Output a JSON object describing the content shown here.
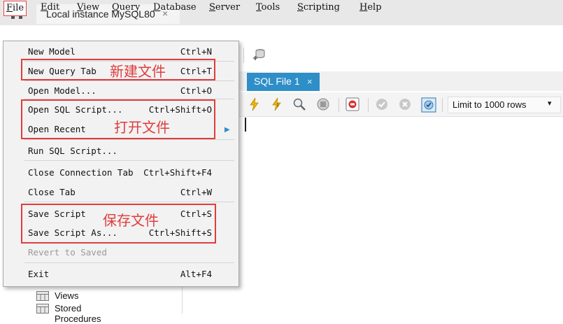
{
  "tabs": {
    "connection_title": "Local instance MySQL80",
    "close_glyph": "×"
  },
  "menubar": {
    "items": [
      {
        "pre": "",
        "key": "F",
        "post": "ile"
      },
      {
        "pre": "",
        "key": "E",
        "post": "dit"
      },
      {
        "pre": "",
        "key": "V",
        "post": "iew"
      },
      {
        "pre": "",
        "key": "Q",
        "post": "uery"
      },
      {
        "pre": "",
        "key": "D",
        "post": "atabase"
      },
      {
        "pre": "",
        "key": "S",
        "post": "erver"
      },
      {
        "pre": "",
        "key": "T",
        "post": "ools"
      },
      {
        "pre": "",
        "key": "S",
        "post": "cripting"
      },
      {
        "pre": "",
        "key": "H",
        "post": "elp"
      }
    ]
  },
  "file_menu": {
    "new_model": {
      "label": "New Model",
      "shortcut": "Ctrl+N"
    },
    "new_query_tab": {
      "label": "New Query Tab",
      "shortcut": "Ctrl+T"
    },
    "open_model": {
      "label": "Open Model...",
      "shortcut": "Ctrl+O"
    },
    "open_sql_script": {
      "label": "Open SQL Script...",
      "shortcut": "Ctrl+Shift+O"
    },
    "open_recent": {
      "label": "Open Recent",
      "shortcut": ""
    },
    "run_sql_script": {
      "label": "Run SQL Script...",
      "shortcut": ""
    },
    "close_connection_tab": {
      "label": "Close Connection Tab",
      "shortcut": "Ctrl+Shift+F4"
    },
    "close_tab": {
      "label": "Close Tab",
      "shortcut": "Ctrl+W"
    },
    "save_script": {
      "label": "Save Script",
      "shortcut": "Ctrl+S"
    },
    "save_script_as": {
      "label": "Save Script As...",
      "shortcut": "Ctrl+Shift+S"
    },
    "revert_to_saved": {
      "label": "Revert to Saved",
      "shortcut": ""
    },
    "exit": {
      "label": "Exit",
      "shortcut": "Alt+F4"
    }
  },
  "annotations": {
    "new_file": "新建文件",
    "open_file": "打开文件",
    "save_file": "保存文件"
  },
  "editor": {
    "tab_label": "SQL File 1",
    "limit_select": "Limit to 1000 rows"
  },
  "navigator": {
    "views": "Views",
    "stored_procedures": "Stored Procedures"
  },
  "colors": {
    "accent": "#2e8ec8",
    "highlight": "#e03c3c"
  }
}
